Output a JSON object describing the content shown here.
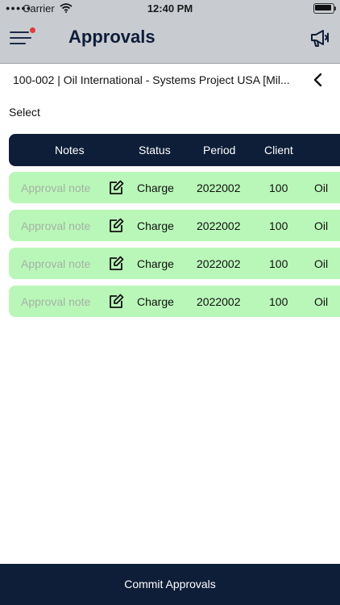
{
  "status_bar": {
    "carrier": "Carrier",
    "time": "12:40 PM"
  },
  "header": {
    "title": "Approvals",
    "menu_icon": "hamburger-menu-icon",
    "notification_color": "#e0393e",
    "action_icon": "megaphone-icon"
  },
  "project": {
    "name": "100-002 | Oil International - Systems Project USA [Mil..."
  },
  "select_label": "Select",
  "table": {
    "headers": {
      "notes": "Notes",
      "status": "Status",
      "period": "Period",
      "client": "Client"
    },
    "rows": [
      {
        "note_placeholder": "Approval note",
        "status": "Charge",
        "period": "2022002",
        "client": "100",
        "client_name": "Oil"
      },
      {
        "note_placeholder": "Approval note",
        "status": "Charge",
        "period": "2022002",
        "client": "100",
        "client_name": "Oil"
      },
      {
        "note_placeholder": "Approval note",
        "status": "Charge",
        "period": "2022002",
        "client": "100",
        "client_name": "Oil"
      },
      {
        "note_placeholder": "Approval note",
        "status": "Charge",
        "period": "2022002",
        "client": "100",
        "client_name": "Oil"
      }
    ]
  },
  "footer": {
    "commit_label": "Commit Approvals"
  },
  "colors": {
    "header_bg": "#c8ccd1",
    "navy": "#0e1d38",
    "row_bg": "#b9f7b8",
    "placeholder": "#a6b1a6"
  }
}
